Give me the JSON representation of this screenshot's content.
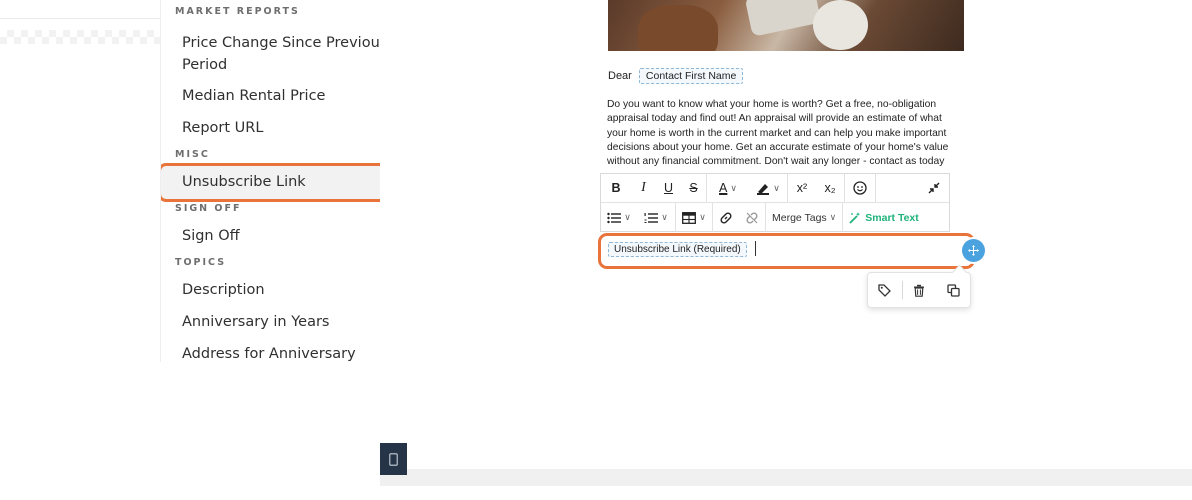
{
  "sidebar": {
    "sections": {
      "market_reports": "MARKET REPORTS",
      "misc": "MISC",
      "sign_off": "SIGN OFF",
      "topics": "TOPICS"
    },
    "items": {
      "price_change": "Price Change Since Previous Period",
      "median_rental": "Median Rental Price",
      "report_url": "Report URL",
      "unsubscribe": "Unsubscribe Link",
      "sign_off": "Sign Off",
      "description": "Description",
      "anniversary_years": "Anniversary in Years",
      "address_anniversary": "Address for Anniversary"
    }
  },
  "email": {
    "greeting": "Dear",
    "contact_merge": "Contact First Name",
    "body": " Do you want to know what your home is worth? Get a free, no-obligation appraisal today and find out! An appraisal will provide an estimate of what your home is worth in the current market and can help you make important decisions about your home. Get an accurate estimate of your home's value without any financial commitment. Don't wait any longer - contact as today",
    "unsubscribe_chip": "Unsubscribe Link (Required)"
  },
  "toolbar": {
    "bold": "B",
    "italic": "I",
    "underline": "U",
    "strike": "S",
    "text_color": "A",
    "superscript": "x²",
    "subscript": "x₂",
    "merge_tags": "Merge Tags",
    "smart_text": "Smart Text"
  },
  "colors": {
    "accent": "#e8743b",
    "handle": "#4aa3df",
    "smart_text": "#1eb37a",
    "merge_border": "#8fb8d8"
  },
  "icons": [
    "emoji-icon",
    "collapse-icon",
    "bullet-list-icon",
    "numbered-list-icon",
    "table-icon",
    "link-icon",
    "unlink-icon",
    "magic-wand-icon",
    "drag-handle-icon",
    "tag-icon",
    "trash-icon",
    "duplicate-icon",
    "mobile-icon"
  ]
}
